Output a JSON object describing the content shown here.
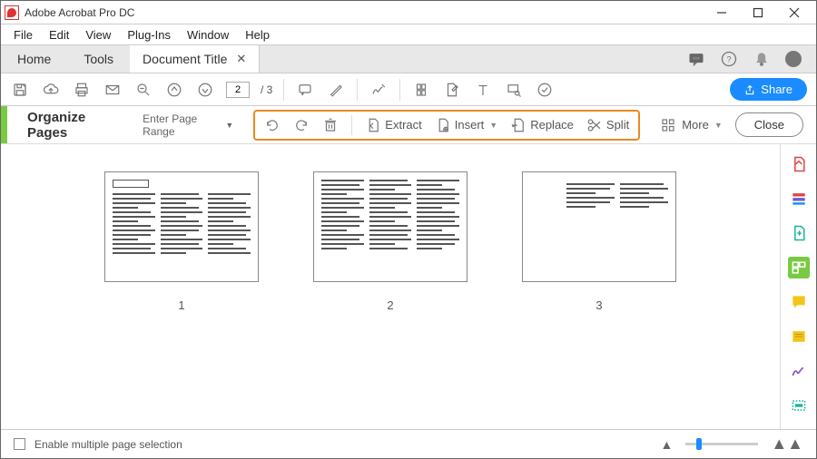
{
  "window": {
    "title": "Adobe Acrobat Pro DC"
  },
  "menu": {
    "items": [
      "File",
      "Edit",
      "View",
      "Plug-Ins",
      "Window",
      "Help"
    ]
  },
  "tabs": {
    "home": "Home",
    "tools": "Tools",
    "doc_title": "Document Title"
  },
  "toolbar": {
    "page_current": "2",
    "page_total": "/ 3",
    "share_label": "Share"
  },
  "orgbar": {
    "title": "Organize Pages",
    "page_range": "Enter Page Range",
    "extract_label": "Extract",
    "insert_label": "Insert",
    "replace_label": "Replace",
    "split_label": "Split",
    "more_label": "More",
    "close_label": "Close"
  },
  "thumbs": {
    "labels": [
      "1",
      "2",
      "3"
    ]
  },
  "bottom": {
    "enable_multi": "Enable multiple page selection"
  },
  "colors": {
    "accent": "#1a8cff",
    "green": "#7ac943",
    "highlight_border": "#e98b1f"
  }
}
